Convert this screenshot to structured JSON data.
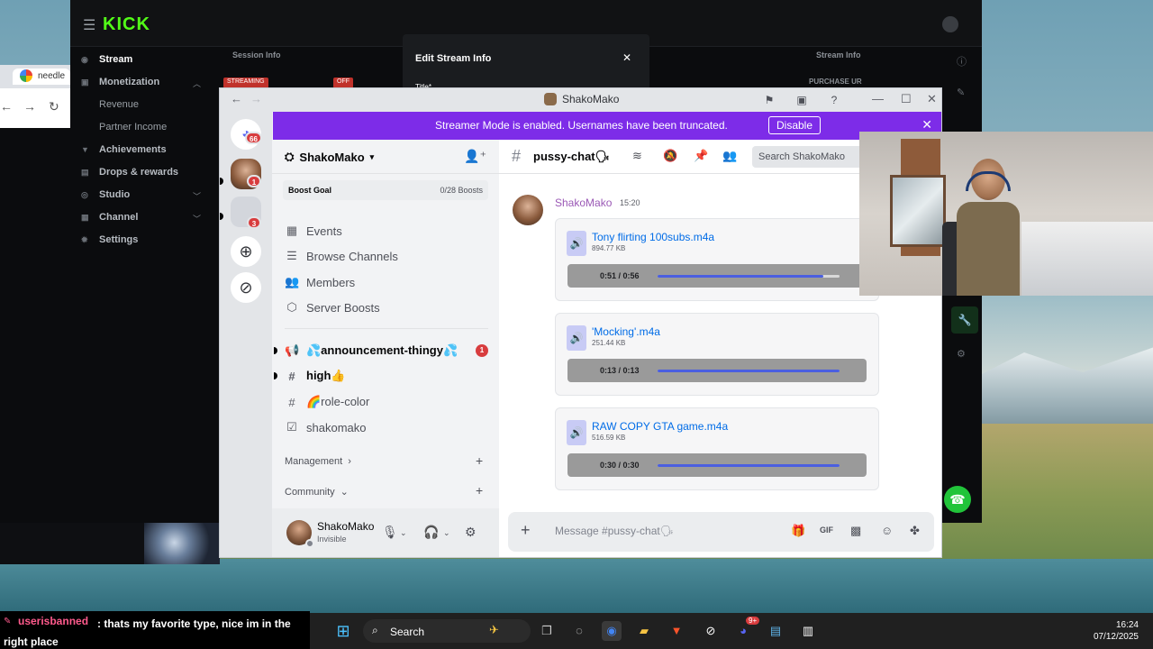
{
  "kick": {
    "logo": "KICK",
    "nav": [
      {
        "label": "Stream",
        "active": true
      },
      {
        "label": "Monetization"
      },
      {
        "label": "Revenue",
        "sub": true
      },
      {
        "label": "Partner Income",
        "sub": true
      },
      {
        "label": "Achievements"
      },
      {
        "label": "Drops & rewards"
      },
      {
        "label": "Studio"
      },
      {
        "label": "Channel"
      },
      {
        "label": "Settings"
      }
    ],
    "panels": {
      "session_info": "Session Info",
      "stream_info": "Stream Info"
    },
    "tags": {
      "streaming": "STREAMING",
      "off": "OFF"
    },
    "purchase_text": "PURCHASE UR",
    "edit_modal": {
      "title": "Edit Stream Info",
      "field_label": "Title*"
    }
  },
  "chrome": {
    "tab_title": "needle"
  },
  "discord": {
    "window_title": "ShakoMako",
    "streamer_banner": {
      "text": "Streamer Mode is enabled. Usernames have been truncated.",
      "button": "Disable"
    },
    "guild_badges": {
      "home": "66",
      "g1": "1",
      "g2": "3"
    },
    "server": {
      "name": "ShakoMako",
      "boost_goal": "Boost Goal",
      "boost_count": "0/28 Boosts",
      "nav": [
        "Events",
        "Browse Channels",
        "Members",
        "Server Boosts"
      ],
      "channels": [
        {
          "name": "💦announcement-thingy💦",
          "badge": "1",
          "unread": true
        },
        {
          "name": "high👍",
          "unread": true
        },
        {
          "name": "🌈role-color"
        },
        {
          "name": "shakomako"
        }
      ],
      "categories": [
        "Management",
        "Community"
      ]
    },
    "user_panel": {
      "name": "ShakoMako",
      "status": "Invisible"
    },
    "channel": {
      "name": "pussy-chat🗣"
    },
    "search_placeholder": "Search ShakoMako",
    "message": {
      "author": "ShakoMako",
      "time": "15:20"
    },
    "attachments": [
      {
        "name": "Tony flirting 100subs.m4a",
        "size": "894.77 KB",
        "time": "0:51 / 0:56",
        "progress": 0.91
      },
      {
        "name": "'Mocking'.m4a",
        "size": "251.44 KB",
        "time": "0:13 / 0:13",
        "progress": 1.0
      },
      {
        "name": "RAW COPY GTA game.m4a",
        "size": "516.59 KB",
        "time": "0:30 / 0:30",
        "progress": 1.0
      }
    ],
    "composer_placeholder": "Message #pussy-chat🗣"
  },
  "taskbar": {
    "search_label": "Search",
    "time": "16:24",
    "date": "07/12/2025",
    "discord_badge": "9+"
  },
  "stream_chat": {
    "username": "userisbanned",
    "message": ": thats my favorite type, nice im in the right place"
  },
  "colors": {
    "kick_green": "#53fc18",
    "discord_blurple": "#5865f2",
    "streamer_banner": "#7d2ce8",
    "author": "#9b59b6"
  }
}
